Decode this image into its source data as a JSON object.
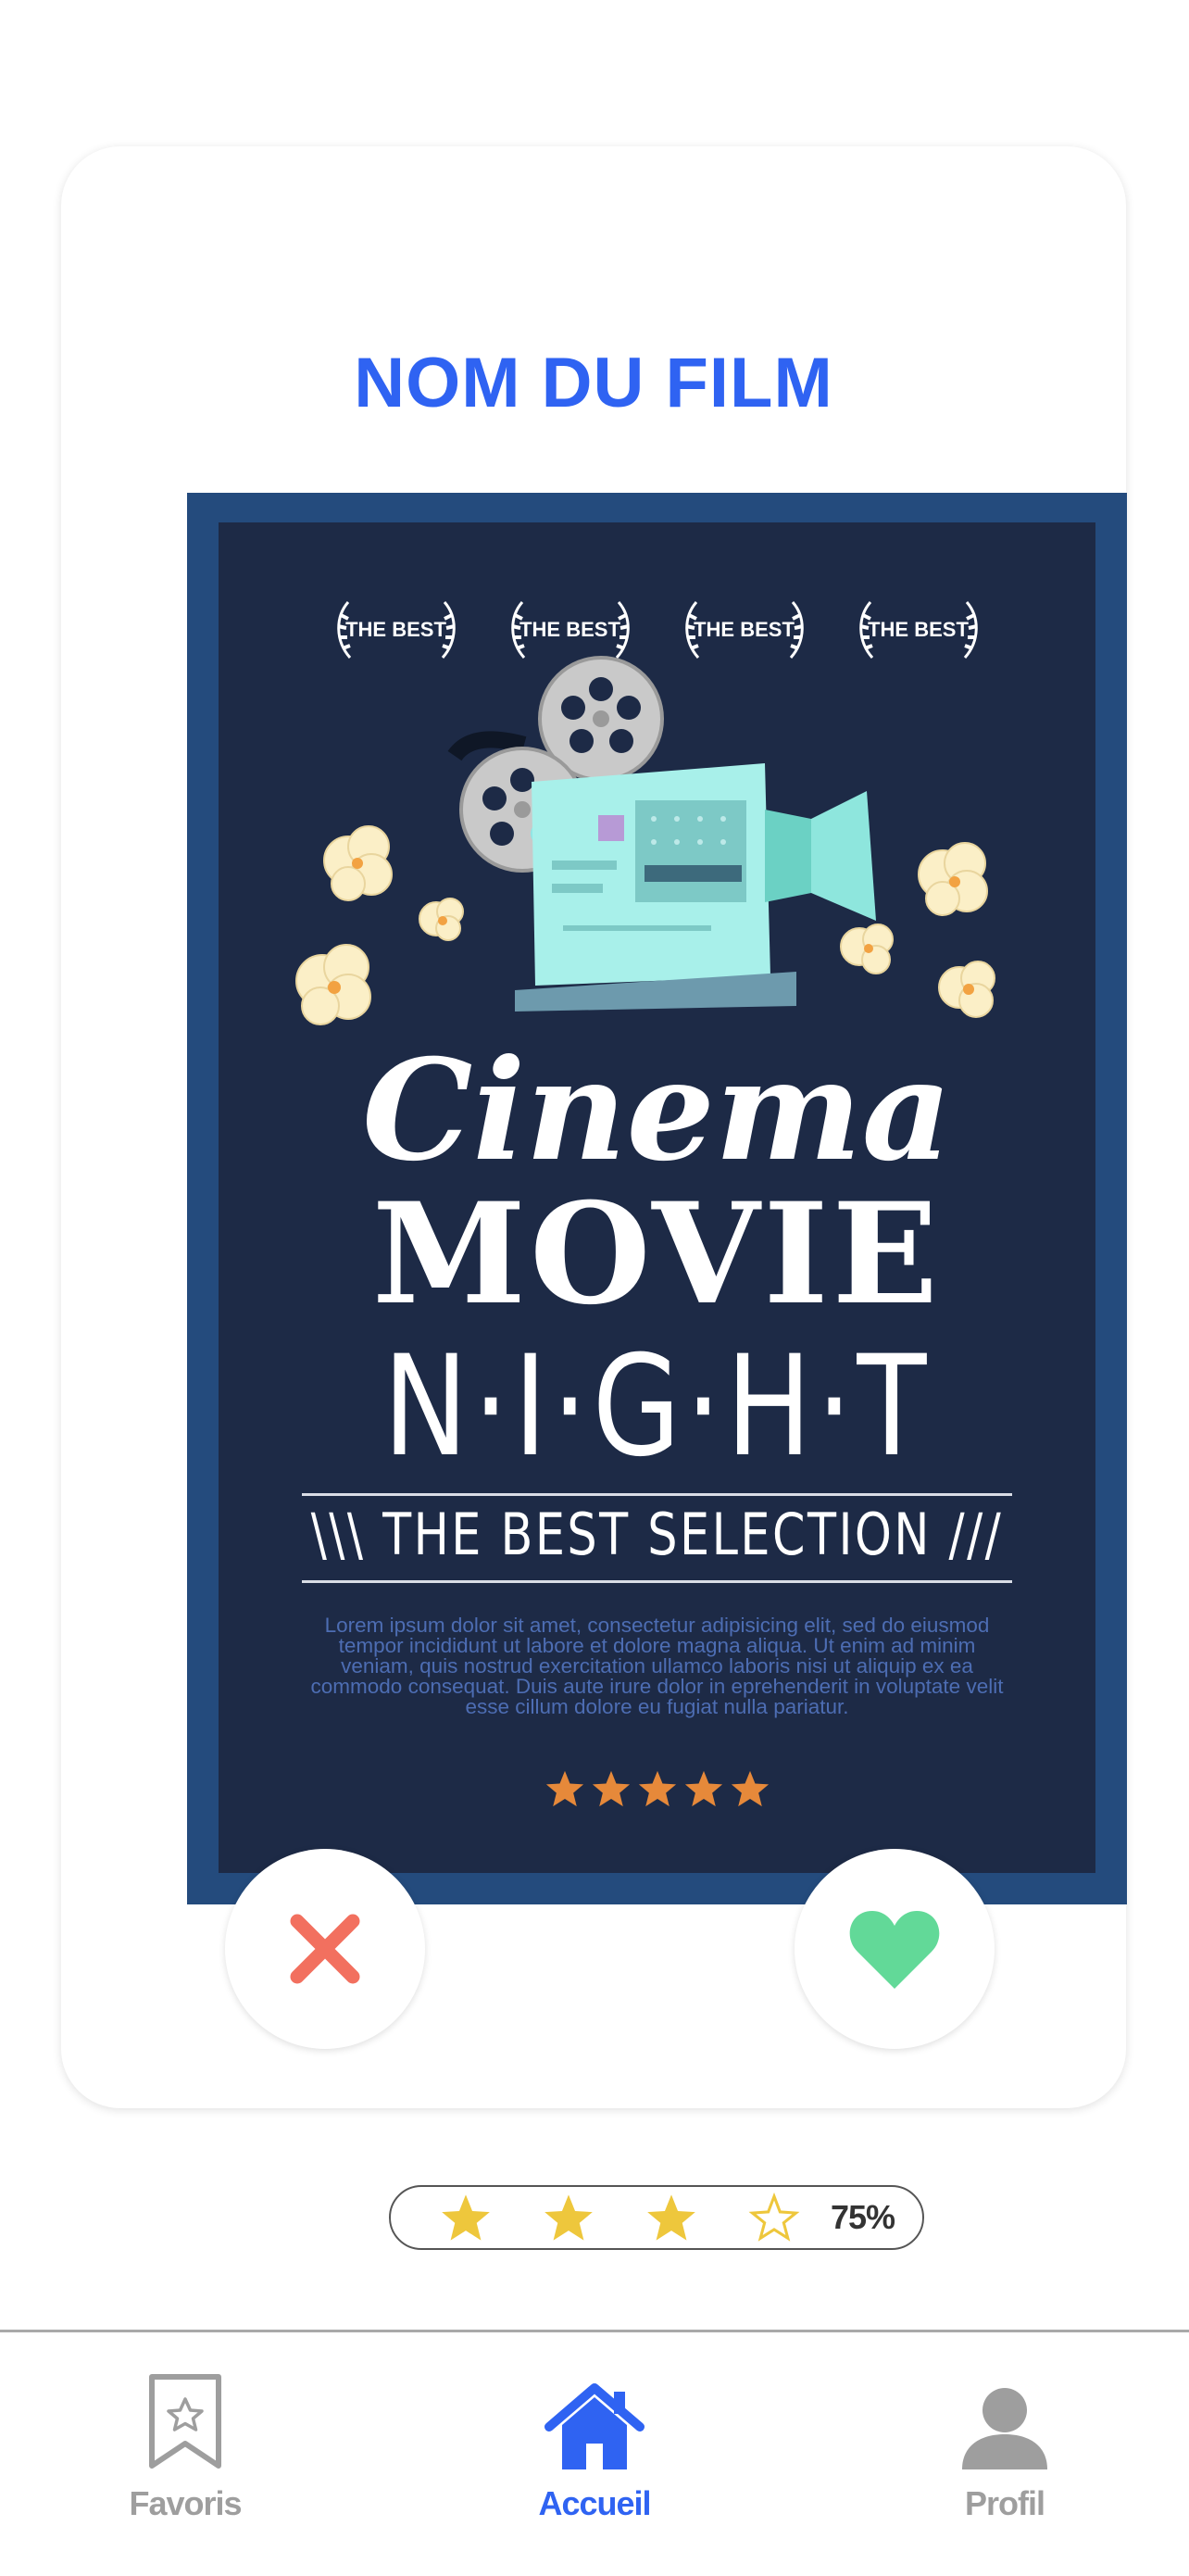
{
  "movie": {
    "title": "NOM DU FILM",
    "poster": {
      "awards": [
        "THE BEST",
        "THE BEST",
        "THE BEST",
        "THE BEST"
      ],
      "line1": "Cinema",
      "line2": "MOVIE",
      "line3": "N·I·G·H·T",
      "tagline": "\\\\\\ THE BEST SELECTION ///",
      "body_text": "Lorem ipsum dolor sit amet, consectetur adipisicing elit, sed do eiusmod tempor incididunt ut labore et dolore magna aliqua. Ut enim ad minim veniam, quis nostrud exercitation ullamco laboris nisi ut aliquip ex ea commodo consequat. Duis aute irure dolor in eprehenderit in voluptate velit esse cillum dolore eu fugiat nulla pariatur.",
      "star_count": 5
    }
  },
  "actions": {
    "dislike_icon": "close-icon",
    "like_icon": "heart-icon"
  },
  "rating": {
    "stars_filled": 3,
    "stars_total": 4,
    "value_label": "75%"
  },
  "nav": {
    "items": [
      {
        "label": "Favoris",
        "icon": "bookmark-star-icon",
        "active": false
      },
      {
        "label": "Accueil",
        "icon": "home-icon",
        "active": true
      },
      {
        "label": "Profil",
        "icon": "user-icon",
        "active": false
      }
    ]
  },
  "colors": {
    "accent": "#2f63f2",
    "dislike": "#f2705f",
    "like": "#62d998",
    "star": "#eec73c",
    "inactive": "#9e9e9e"
  }
}
